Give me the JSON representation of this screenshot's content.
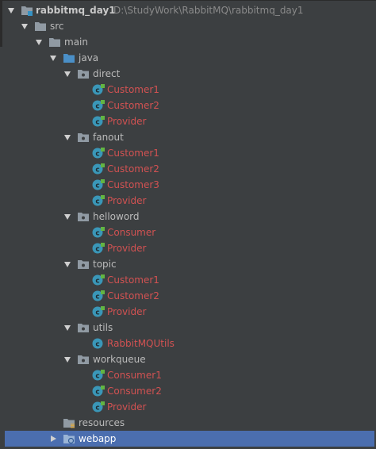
{
  "project": {
    "name": "rabbitmq_day1",
    "path": "D:\\StudyWork\\RabbitMQ\\rabbitmq_day1"
  },
  "folders": {
    "src": "src",
    "main": "main",
    "java": "java",
    "resources": "resources",
    "webapp": "webapp"
  },
  "packages": {
    "direct": {
      "name": "direct",
      "classes": [
        "Customer1",
        "Customer2",
        "Provider"
      ]
    },
    "fanout": {
      "name": "fanout",
      "classes": [
        "Customer1",
        "Customer2",
        "Customer3",
        "Provider"
      ]
    },
    "helloword": {
      "name": "helloword",
      "classes": [
        "Consumer",
        "Provider"
      ]
    },
    "topic": {
      "name": "topic",
      "classes": [
        "Customer1",
        "Customer2",
        "Provider"
      ]
    },
    "utils": {
      "name": "utils",
      "classes": [
        "RabbitMQUtils"
      ]
    },
    "workqueue": {
      "name": "workqueue",
      "classes": [
        "Consumer1",
        "Consumer2",
        "Provider"
      ]
    }
  },
  "selected_item": "webapp",
  "colors": {
    "background": "#3c3f41",
    "selection": "#4b6eaf",
    "class_name_error": "#d25252",
    "text": "#bbbbbb",
    "path_text": "#8a8a8a",
    "class_icon": "#3a97b8",
    "folder_icon": "#909aa3",
    "source_folder_icon": "#4a8fc7"
  },
  "icons": {
    "expanded_arrow": "triangle-down-icon",
    "collapsed_arrow": "triangle-right-icon",
    "module": "module-folder-icon",
    "folder": "folder-icon",
    "source_root": "source-root-folder-icon",
    "package": "package-icon",
    "class": "java-class-icon",
    "resources_root": "resources-root-folder-icon",
    "web_folder": "web-folder-icon"
  }
}
